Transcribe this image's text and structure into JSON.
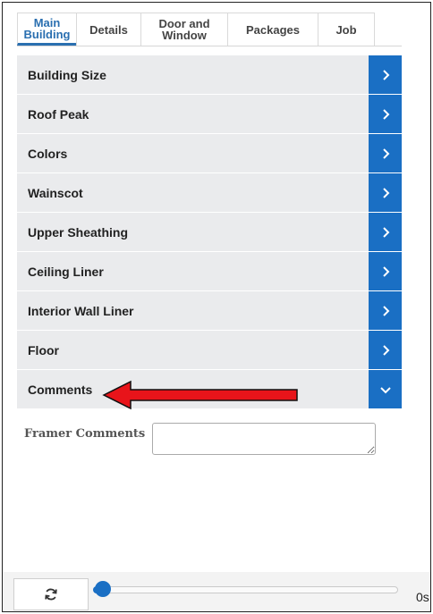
{
  "tabs": [
    {
      "label": "Main Building",
      "active": true
    },
    {
      "label": "Details",
      "active": false
    },
    {
      "label": "Door and Window",
      "active": false
    },
    {
      "label": "Packages",
      "active": false
    },
    {
      "label": "Job",
      "active": false
    }
  ],
  "sections": [
    {
      "label": "Building Size",
      "icon": "chevron-right-icon"
    },
    {
      "label": "Roof Peak",
      "icon": "chevron-right-icon"
    },
    {
      "label": "Colors",
      "icon": "chevron-right-icon"
    },
    {
      "label": "Wainscot",
      "icon": "chevron-right-icon"
    },
    {
      "label": "Upper Sheathing",
      "icon": "chevron-right-icon"
    },
    {
      "label": "Ceiling Liner",
      "icon": "chevron-right-icon"
    },
    {
      "label": "Interior Wall Liner",
      "icon": "chevron-right-icon"
    },
    {
      "label": "Floor",
      "icon": "chevron-right-icon"
    },
    {
      "label": "Comments",
      "icon": "chevron-down-icon"
    }
  ],
  "comments": {
    "field_label": "Framer Comments",
    "value": ""
  },
  "annotation": {
    "color": "#e8141a"
  },
  "footer": {
    "refresh_icon": "refresh-icon",
    "slider_value": 0,
    "time": "0s"
  },
  "colors": {
    "accent": "#1a6fc4",
    "row_bg": "#eaebed"
  }
}
